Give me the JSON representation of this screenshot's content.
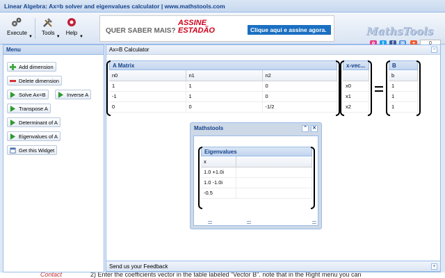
{
  "window": {
    "title": "Linear Algebra: Ax=b solver and eigenvalues calculator | www.mathstools.com"
  },
  "toolbar": {
    "execute_label": "Execute",
    "tools_label": "Tools",
    "help_label": "Help"
  },
  "ad": {
    "text": "QUER SABER MAIS?",
    "logo_line1": "ASSINE",
    "logo_line2": "ESTADÃO",
    "cta": "Clique aqui e assine agora."
  },
  "brand": {
    "name": "MathsTools"
  },
  "share": {
    "count": "0"
  },
  "menu": {
    "title": "Menu",
    "items": [
      {
        "label": "Add dimension",
        "icon": "plus-icon"
      },
      {
        "label": "Delete dimension",
        "icon": "minus-icon"
      },
      {
        "label": "Solve Ax=B",
        "icon": "play-icon"
      },
      {
        "label": "Inverse A",
        "icon": "play-icon"
      },
      {
        "label": "Transpose A",
        "icon": "play-icon"
      },
      {
        "label": "Determinant of A",
        "icon": "play-icon"
      },
      {
        "label": "Eigenvalues of A",
        "icon": "play-icon"
      },
      {
        "label": "Get this Widget",
        "icon": "widget-icon"
      }
    ]
  },
  "calculator": {
    "title": "Ax=B Calculator",
    "a_matrix": {
      "title": "A Matrix",
      "headers": [
        "n0",
        "n1",
        "n2"
      ],
      "rows": [
        [
          "1",
          "1",
          "0"
        ],
        [
          "-1",
          "1",
          "0"
        ],
        [
          "0",
          "0",
          "-1/2"
        ]
      ]
    },
    "x_vector": {
      "title": "x-vec...",
      "rows": [
        "x0",
        "x1",
        "x2"
      ]
    },
    "b_vector": {
      "title": "B",
      "header": "b",
      "rows": [
        "1",
        "1",
        "1"
      ]
    }
  },
  "dialog": {
    "title": "Mathstools",
    "eigen_title": "Eigenvalues",
    "header": "x",
    "rows": [
      "1.0 +1.0i",
      "1.0 -1.0i",
      "-0.5"
    ]
  },
  "feedback": {
    "label": "Send us your Feedback"
  },
  "bottom": {
    "left_text": "Contact",
    "right_text": "2) Enter the coefficients vector in the table labeled \"Vector B\". note that in the Right menu you can"
  },
  "colors": {
    "header_blue": "#15428b",
    "panel_border": "#99bbe8",
    "background": "#dfe8f6"
  }
}
